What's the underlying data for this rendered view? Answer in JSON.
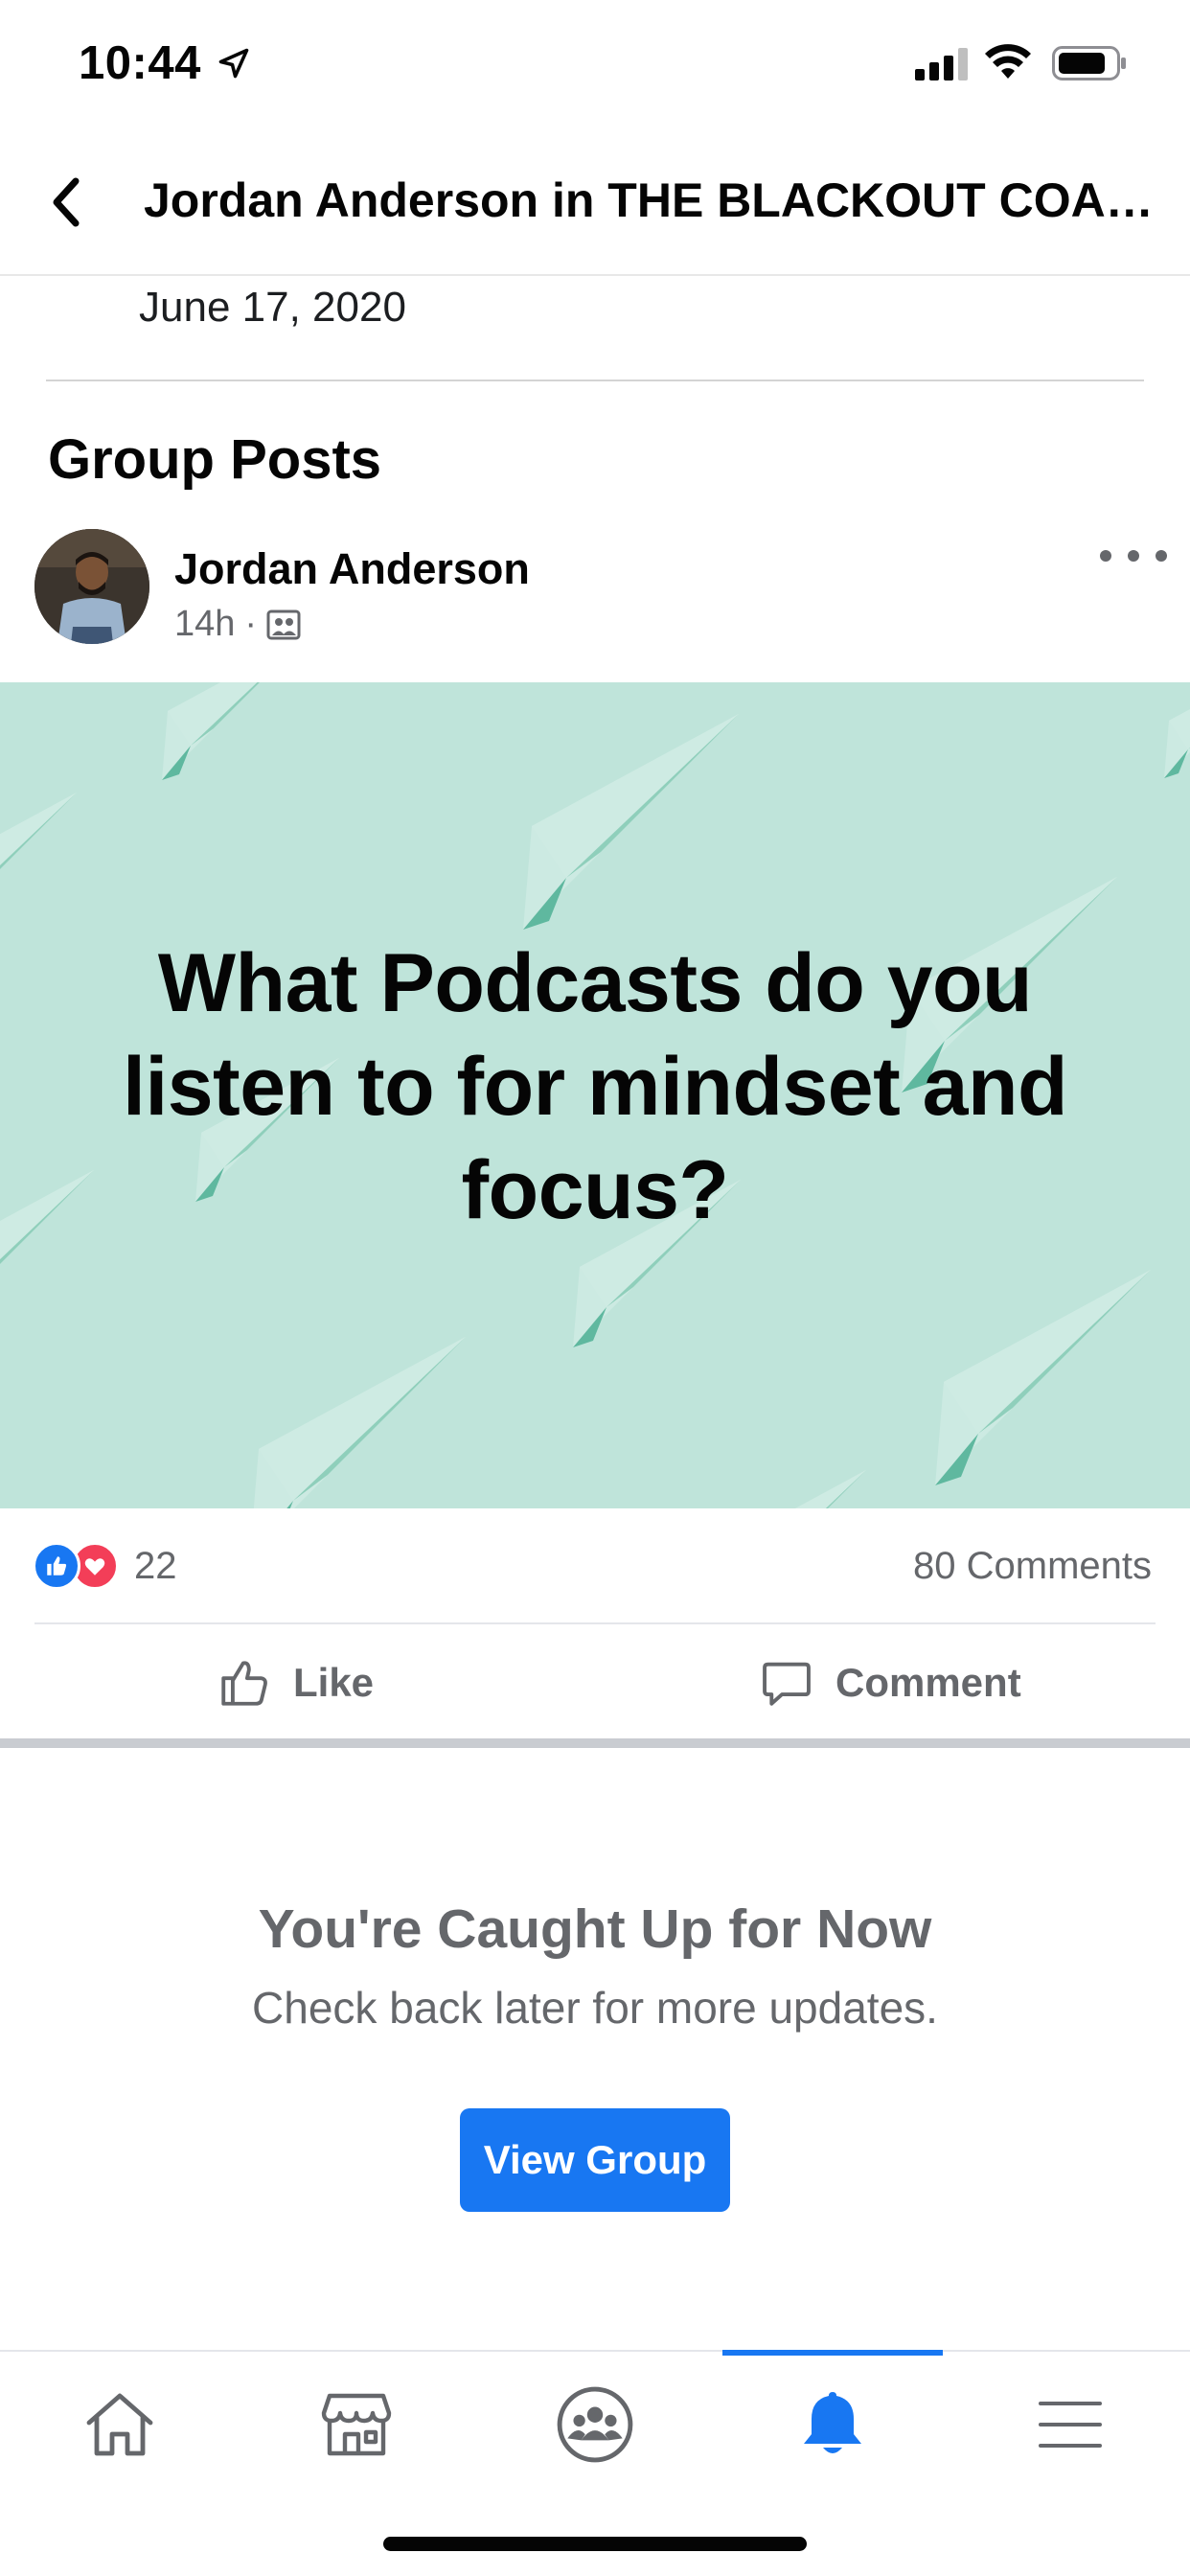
{
  "status_bar": {
    "time": "10:44",
    "icons": [
      "location-arrow-icon",
      "cellular-signal-icon",
      "wifi-icon",
      "battery-icon"
    ]
  },
  "header": {
    "back_icon": "chevron-left-icon",
    "title": "Jordan Anderson in THE BLACKOUT COAL..."
  },
  "date": "June 17, 2020",
  "section_title": "Group Posts",
  "post": {
    "author": "Jordan Anderson",
    "time": "14h",
    "separator": "·",
    "audience_icon": "group-photo-icon",
    "image_text": "What Podcasts do you listen to for mindset and focus?",
    "image_background": "#bfe4da",
    "reactions": {
      "types": [
        "like",
        "love"
      ],
      "count": "22"
    },
    "comments": "80 Comments",
    "actions": {
      "like": "Like",
      "comment": "Comment"
    }
  },
  "caught_up": {
    "title": "You're Caught Up for Now",
    "subtitle": "Check back later for more updates.",
    "button": "View Group"
  },
  "tab_bar": {
    "tabs": [
      {
        "name": "home",
        "icon": "home-icon",
        "active": false
      },
      {
        "name": "marketplace",
        "icon": "marketplace-icon",
        "active": false
      },
      {
        "name": "groups",
        "icon": "groups-icon",
        "active": false
      },
      {
        "name": "notifications",
        "icon": "bell-icon",
        "active": true
      },
      {
        "name": "menu",
        "icon": "menu-icon",
        "active": false
      }
    ]
  },
  "colors": {
    "accent": "#1877f2",
    "love": "#f33e58",
    "secondary_text": "#65676b"
  }
}
